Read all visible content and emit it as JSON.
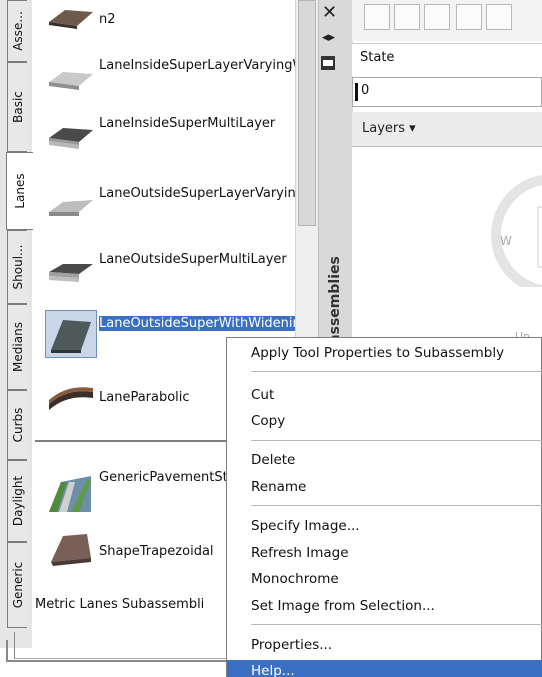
{
  "palette": {
    "title": "assemblies",
    "side_tabs": [
      "Asse...",
      "Basic",
      "Lanes",
      "Shoul...",
      "Medians",
      "Curbs",
      "Daylight",
      "Generic"
    ],
    "active_tab": "Lanes"
  },
  "tools": [
    {
      "label": "n2"
    },
    {
      "label": "LaneInsideSuperLayerVaryingWidth"
    },
    {
      "label": "LaneInsideSuperMultiLayer"
    },
    {
      "label": "LaneOutsideSuperLayerVaryingWidth"
    },
    {
      "label": "LaneOutsideSuperMultiLayer"
    },
    {
      "label": "LaneOutsideSuperWithWidening"
    },
    {
      "label": "LaneParabolic"
    },
    {
      "label": "GenericPavementStructure"
    },
    {
      "label": "ShapeTrapezoidal"
    }
  ],
  "footer_label": "Metric Lanes Subassembli",
  "right_panel": {
    "state_label": "State",
    "value": "0",
    "layers_label": "Layers",
    "compass_letter": "W",
    "ucs_text": "Un"
  },
  "context_menu": {
    "items": [
      "Apply Tool Properties to Subassembly",
      "Cut",
      "Copy",
      "Delete",
      "Rename",
      "Specify Image...",
      "Refresh Image",
      "Monochrome",
      "Set Image from Selection...",
      "Properties...",
      "Help..."
    ],
    "highlighted": "Help..."
  },
  "colors": {
    "selection": "#3a6fc4",
    "panel": "#d9d9d9"
  }
}
